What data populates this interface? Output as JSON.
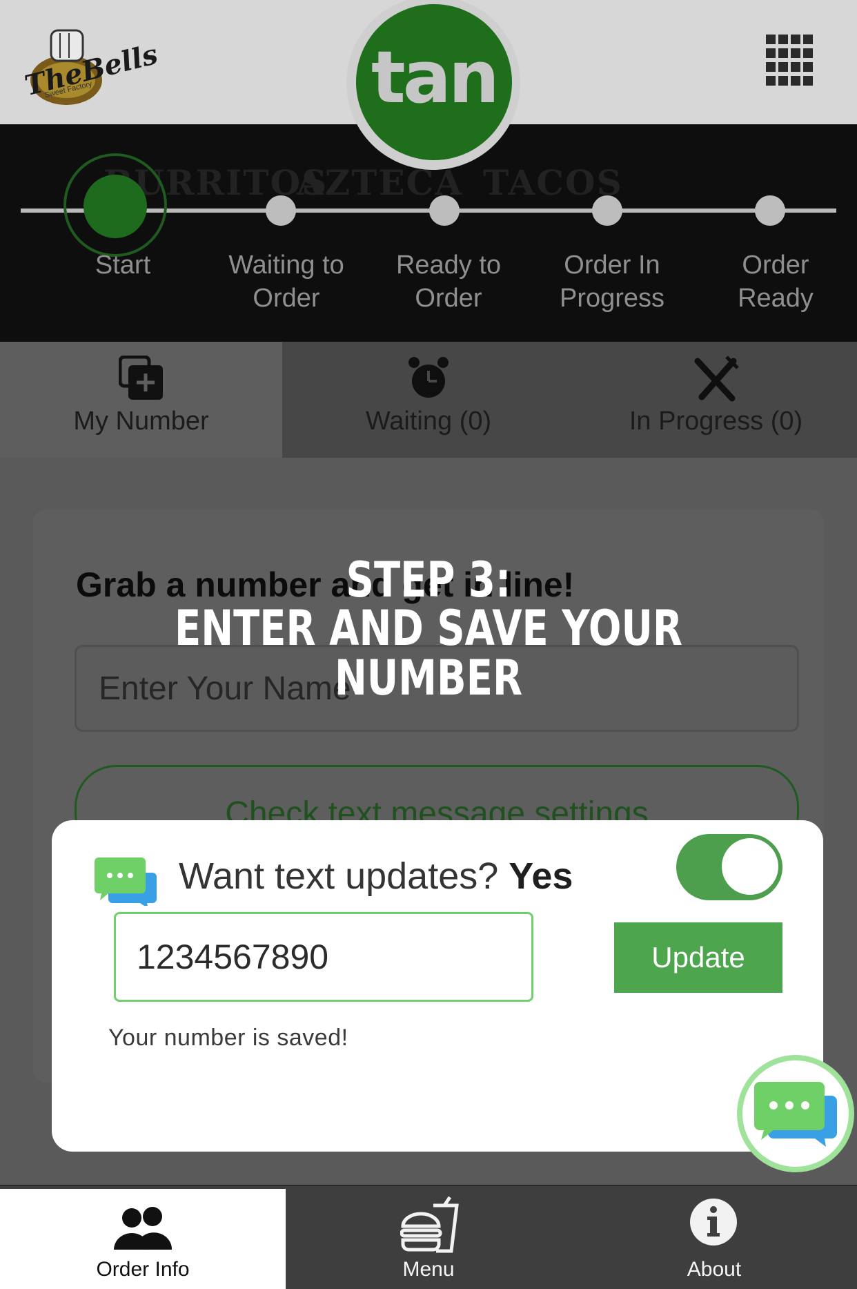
{
  "header": {
    "logo_text": "TheBells",
    "logo_sub": "Sweet Factory",
    "brand": "tan"
  },
  "progress": {
    "steps": [
      {
        "label": "Start",
        "active": true
      },
      {
        "label": "Waiting to Order",
        "active": false
      },
      {
        "label": "Ready to Order",
        "active": false
      },
      {
        "label": "Order In Progress",
        "active": false
      },
      {
        "label": "Order Ready",
        "active": false
      }
    ],
    "background_words": [
      "BURRITOS",
      "AZTECA",
      "TACOS"
    ]
  },
  "tabs": [
    {
      "label": "My Number",
      "icon": "add-number-icon",
      "selected": true
    },
    {
      "label": "Waiting (0)",
      "icon": "alarm-clock-icon",
      "selected": false
    },
    {
      "label": "In Progress (0)",
      "icon": "utensils-icon",
      "selected": false
    }
  ],
  "card": {
    "title": "Grab a number and get in line!",
    "name_placeholder": "Enter Your Name",
    "sms_settings_label": "Check text message settings"
  },
  "overlay": {
    "line1": "STEP 3:",
    "line2": "ENTER AND SAVE YOUR NUMBER"
  },
  "popup": {
    "question": "Want text updates?",
    "answer": "Yes",
    "toggle_on": true,
    "phone_value": "1234567890",
    "update_label": "Update",
    "saved_message": "Your number is saved!"
  },
  "bottom_nav": [
    {
      "label": "Order Info",
      "icon": "people-icon",
      "selected": true
    },
    {
      "label": "Menu",
      "icon": "burger-drink-icon",
      "selected": false
    },
    {
      "label": "About",
      "icon": "info-icon",
      "selected": false
    }
  ],
  "colors": {
    "brand_green": "#1e6e1b",
    "accent_green": "#4da64d",
    "toggle_green": "#4d9e4d",
    "input_border": "#6fd16b"
  }
}
